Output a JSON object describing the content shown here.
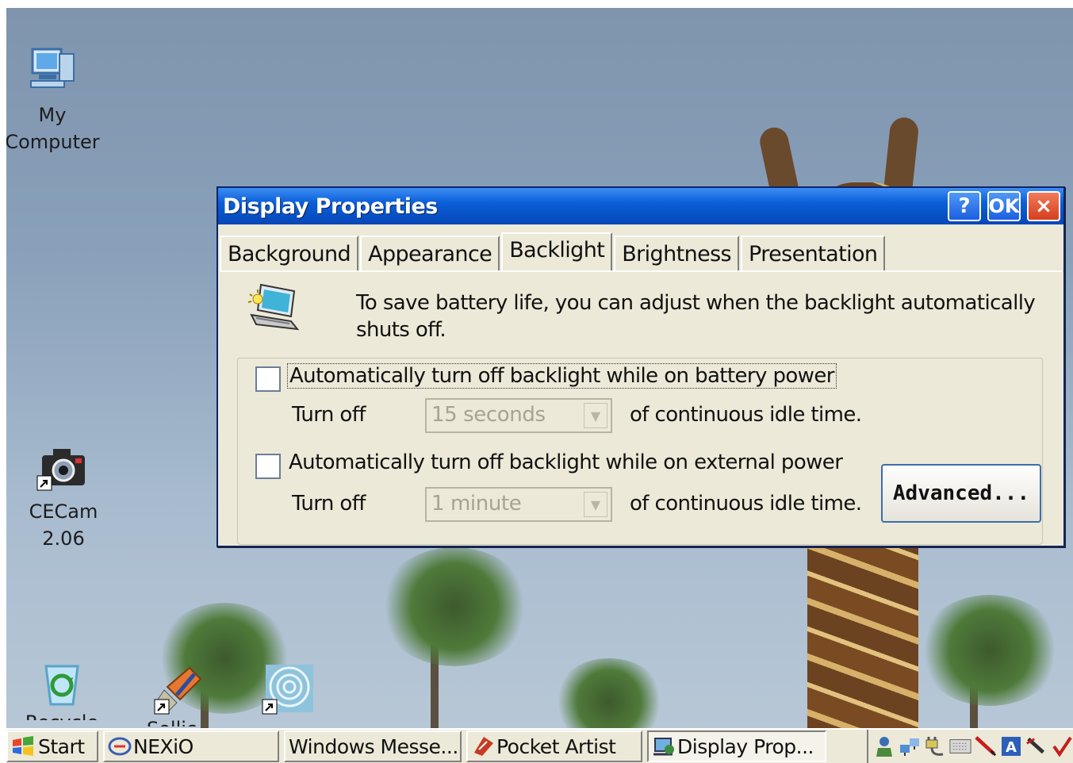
{
  "desktop": {
    "icons": [
      {
        "label": "My\nComputer",
        "icon": "my-computer-icon"
      },
      {
        "label": "CECam\n2.06",
        "icon": "camera-icon"
      },
      {
        "label": "Recycle Bin",
        "icon": "recycle-bin-icon"
      },
      {
        "label": "Sollic...",
        "icon": "paint-shortcut-icon"
      },
      {
        "label": "",
        "icon": "spiral-shortcut-icon"
      }
    ]
  },
  "dialog": {
    "title": "Display Properties",
    "title_buttons": {
      "help": "?",
      "ok": "OK",
      "close": "×"
    },
    "tabs": [
      {
        "label": "Background",
        "active": false
      },
      {
        "label": "Appearance",
        "active": false
      },
      {
        "label": "Backlight",
        "active": true
      },
      {
        "label": "Brightness",
        "active": false
      },
      {
        "label": "Presentation",
        "active": false
      }
    ],
    "intro": "To save battery life, you can adjust when the backlight automatically shuts off.",
    "battery": {
      "checkbox_label": "Automatically turn off backlight while on battery power",
      "checked": false,
      "turn_off_label": "Turn off",
      "value": "15 seconds",
      "suffix": "of continuous idle time."
    },
    "external": {
      "checkbox_label": "Automatically turn off backlight while on external power",
      "checked": false,
      "turn_off_label": "Turn off",
      "value": "1 minute",
      "suffix": "of continuous idle time."
    },
    "advanced_label": "Advanced..."
  },
  "taskbar": {
    "start_label": "Start",
    "tasks": [
      {
        "label": "NEXiO",
        "icon": "nexio-icon"
      },
      {
        "label": "Windows Messe...",
        "icon": ""
      },
      {
        "label": "Pocket Artist",
        "icon": "pocket-artist-icon"
      },
      {
        "label": "Display Prop...",
        "icon": "display-properties-icon",
        "active": true
      }
    ],
    "tray_icons": [
      "user-icon",
      "network-icon",
      "power-plug-icon",
      "keyboard-icon",
      "pen-icon",
      "input-a-icon",
      "stylus-icon",
      "check-icon"
    ]
  },
  "colors": {
    "titlebar": "#0a5fd8",
    "dialog_face": "#ece9d8",
    "close_button": "#d4401e"
  }
}
